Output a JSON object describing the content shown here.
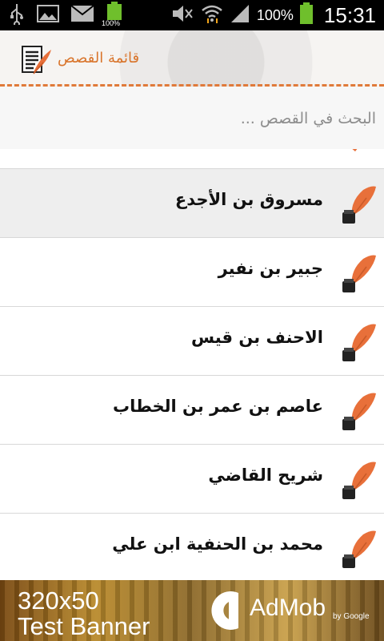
{
  "status_bar": {
    "battery_small_label": "100%",
    "battery_percent": "100%",
    "time": "15:31",
    "icons": [
      "usb-icon",
      "image-icon",
      "email-icon",
      "battery-icon",
      "mute-icon",
      "wifi-icon",
      "signal-icon",
      "battery-icon"
    ]
  },
  "app_bar": {
    "title": "قائمة القصص",
    "icon": "feather-document-icon",
    "accent_color": "#d9742b"
  },
  "search": {
    "placeholder": "البحث في القصص ..."
  },
  "stories": [
    {
      "label": "مسروق بن الأجدع",
      "selected": true
    },
    {
      "label": "جبير بن نفير",
      "selected": false
    },
    {
      "label": "الاحنف بن قيس",
      "selected": false
    },
    {
      "label": "عاصم بن عمر بن الخطاب",
      "selected": false
    },
    {
      "label": "شريح القاضي",
      "selected": false
    },
    {
      "label": "محمد بن الحنفية ابن علي",
      "selected": false
    }
  ],
  "ad": {
    "line1": "320x50",
    "line2": "Test Banner",
    "brand": "AdMob",
    "by": "by Google"
  }
}
